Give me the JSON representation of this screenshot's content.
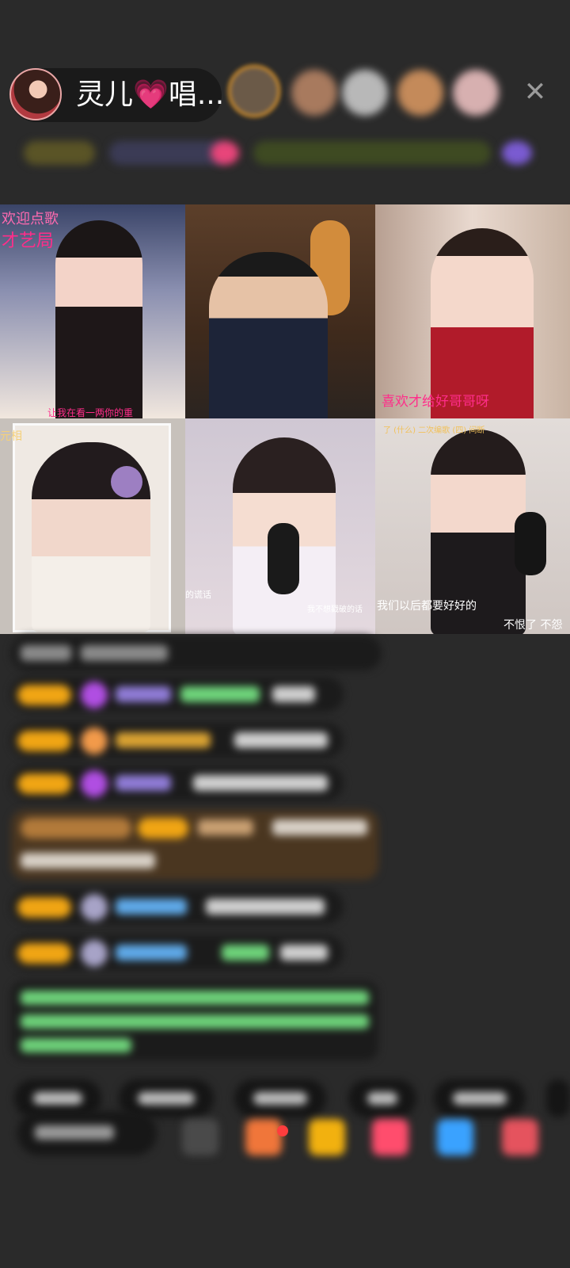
{
  "header": {
    "host_name": "灵儿💗唱...",
    "close_symbol": "✕"
  },
  "grid": {
    "tiles": [
      {
        "captions": [
          "欢迎点歌",
          "才艺局",
          "让我在看一两你的重"
        ]
      },
      {
        "captions": []
      },
      {
        "captions": [
          "喜欢才给好哥哥呀"
        ]
      },
      {
        "captions": [
          "元相"
        ]
      },
      {
        "captions": [
          "的谎话",
          "我不想戳破的话"
        ]
      },
      {
        "captions": [
          "了 (什么) 二次编歌 (四) 间断",
          "我们以后都要好好的",
          "不恨了 不怨"
        ]
      }
    ]
  },
  "colors": {
    "background": "#2a2a2a",
    "badge_gold": "#f0a514",
    "caption_pink": "#ff2d8a",
    "nick_purple": "#8f7bd6",
    "nick_blue": "#5fa9e8",
    "msg_green": "#6ed37a"
  },
  "icons": [
    "close-icon",
    "gift-icon",
    "envelope-icon",
    "star-icon",
    "heart-icon",
    "chat-icon",
    "share-icon"
  ]
}
